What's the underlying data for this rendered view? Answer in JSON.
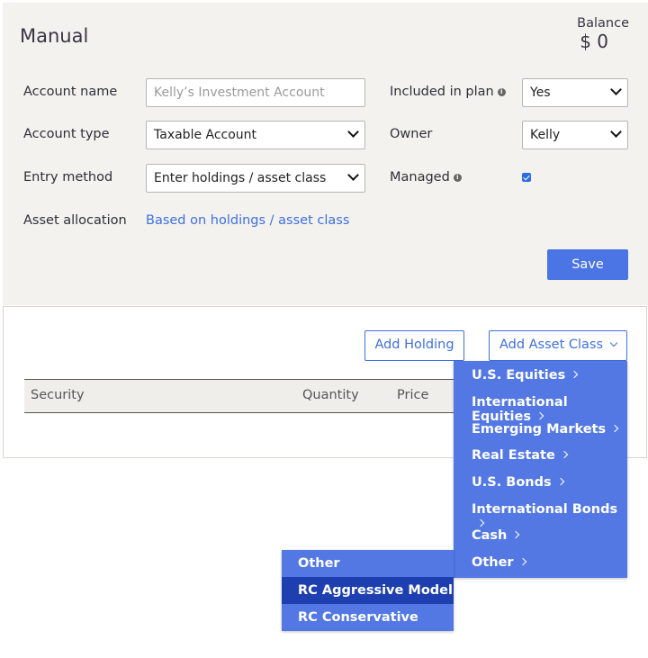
{
  "header": {
    "title": "Manual",
    "balance_label": "Balance",
    "balance_value": "$ 0"
  },
  "form": {
    "account_name_label": "Account name",
    "account_name_placeholder": "Kelly’s Investment Account",
    "account_type_label": "Account type",
    "account_type_value": "Taxable Account",
    "entry_method_label": "Entry method",
    "entry_method_value": "Enter holdings / asset class",
    "asset_allocation_label": "Asset allocation",
    "asset_allocation_link": "Based on holdings / asset class",
    "included_in_plan_label": "Included in plan",
    "included_in_plan_value": "Yes",
    "owner_label": "Owner",
    "owner_value": "Kelly",
    "managed_label": "Managed",
    "managed_checked": true,
    "save_label": "Save"
  },
  "holdings": {
    "add_holding_label": "Add Holding",
    "add_asset_class_label": "Add Asset Class",
    "columns": [
      "Security",
      "Quantity",
      "Price"
    ]
  },
  "asset_class_menu": {
    "items": [
      "U.S. Equities",
      "International Equities",
      "Emerging Markets",
      "Real Estate",
      "U.S. Bonds",
      "International Bonds",
      "Cash",
      "Other"
    ]
  },
  "other_submenu": {
    "items": [
      "Other",
      "RC Aggressive Model",
      "RC Conservative Model"
    ],
    "active_index": 1
  },
  "colors": {
    "accent": "#4b74e4",
    "menu_bg": "#5378e4",
    "menu_active": "#1e3fb0",
    "panel_bg": "#f3f2ef"
  }
}
